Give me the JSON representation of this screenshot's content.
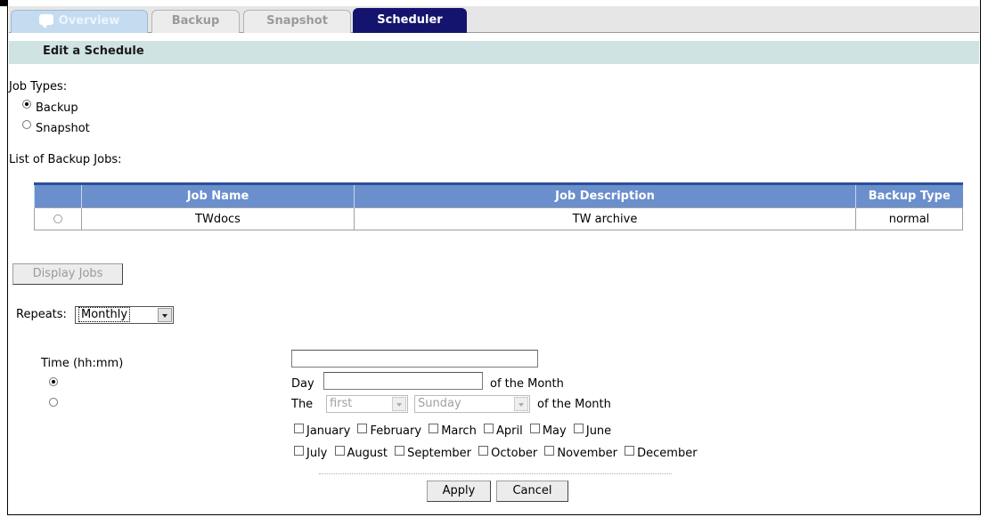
{
  "tabs": [
    {
      "label": "Overview",
      "icon": "chat-bubble-icon"
    },
    {
      "label": "Backup"
    },
    {
      "label": "Snapshot"
    },
    {
      "label": "Scheduler",
      "active": true
    }
  ],
  "page_title": "Edit a Schedule",
  "job_types": {
    "label": "Job Types:",
    "options": [
      {
        "label": "Backup",
        "selected": true
      },
      {
        "label": "Snapshot",
        "selected": false
      }
    ]
  },
  "list_label": "List of Backup Jobs:",
  "jobs_table": {
    "headers": [
      "",
      "Job Name",
      "Job Description",
      "Backup Type"
    ],
    "rows": [
      {
        "name": "TWdocs",
        "description": "TW archive",
        "type": "normal"
      }
    ]
  },
  "display_jobs_button": "Display Jobs",
  "repeats": {
    "label": "Repeats:",
    "value": "Monthly"
  },
  "time_label": "Time (hh:mm)",
  "time_value": "",
  "day_option": {
    "prefix": "Day",
    "value": "",
    "suffix": "of the Month",
    "selected": true
  },
  "the_option": {
    "prefix": "The",
    "ordinal": "first",
    "weekday": "Sunday",
    "suffix": "of the Month",
    "selected": false
  },
  "months_row1": [
    "January",
    "February",
    "March",
    "April",
    "May",
    "June"
  ],
  "months_row2": [
    "July",
    "August",
    "September",
    "October",
    "November",
    "December"
  ],
  "apply_button": "Apply",
  "cancel_button": "Cancel"
}
